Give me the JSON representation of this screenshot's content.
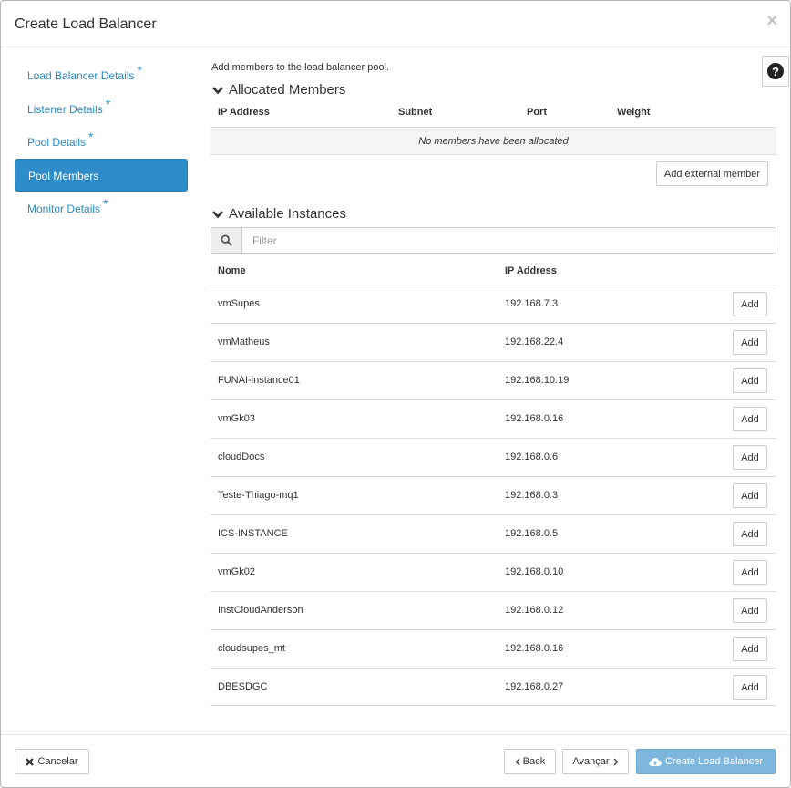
{
  "modal": {
    "title": "Create Load Balancer",
    "close_glyph": "×"
  },
  "nav": {
    "items": [
      {
        "label": "Load Balancer Details",
        "required": "*"
      },
      {
        "label": "Listener Details",
        "required": "*"
      },
      {
        "label": "Pool Details",
        "required": "*"
      },
      {
        "label": "Pool Members",
        "required": ""
      },
      {
        "label": "Monitor Details",
        "required": "*"
      }
    ],
    "active_index": 3
  },
  "help": {
    "glyph": "?"
  },
  "intro": "Add members to the load balancer pool.",
  "allocated": {
    "heading": "Allocated Members",
    "columns": [
      "IP Address",
      "Subnet",
      "Port",
      "Weight"
    ],
    "empty_text": "No members have been allocated",
    "add_external_label": "Add external member"
  },
  "available": {
    "heading": "Available Instances",
    "filter_placeholder": "Filter",
    "columns": [
      "Nome",
      "IP Address"
    ],
    "add_label": "Add",
    "rows": [
      {
        "name": "vmSupes",
        "ip": "192.168.7.3"
      },
      {
        "name": "vmMatheus",
        "ip": "192.168.22.4"
      },
      {
        "name": "FUNAI-instance01",
        "ip": "192.168.10.19"
      },
      {
        "name": "vmGk03",
        "ip": "192.168.0.16"
      },
      {
        "name": "cloudDocs",
        "ip": "192.168.0.6"
      },
      {
        "name": "Teste-Thiago-mq1",
        "ip": "192.168.0.3"
      },
      {
        "name": "ICS-INSTANCE",
        "ip": "192.168.0.5"
      },
      {
        "name": "vmGk02",
        "ip": "192.168.0.10"
      },
      {
        "name": "InstCloudAnderson",
        "ip": "192.168.0.12"
      },
      {
        "name": "cloudsupes_mt",
        "ip": "192.168.0.16"
      },
      {
        "name": "DBESDGC",
        "ip": "192.168.0.27"
      }
    ]
  },
  "footer": {
    "cancel_label": "Cancelar",
    "back_label": "Back",
    "next_label": "Avançar",
    "create_label": "Create Load Balancer"
  },
  "colors": {
    "accent": "#2f8ccb",
    "link": "#2b8ac4",
    "primary_disabled": "#7fb6dd"
  }
}
